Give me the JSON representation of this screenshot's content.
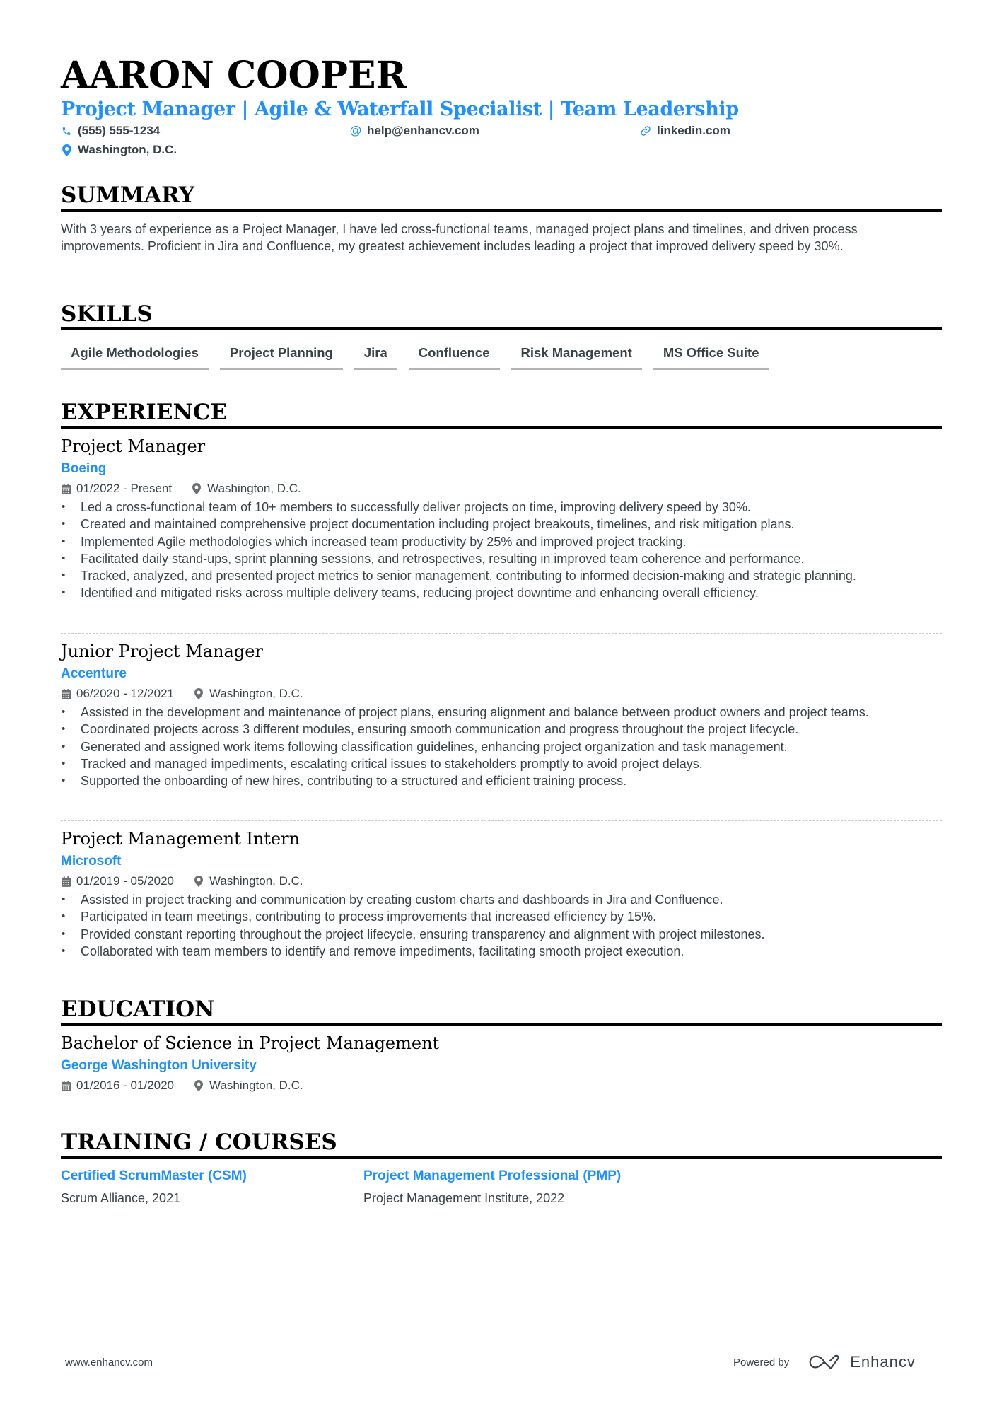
{
  "header": {
    "name": "AARON COOPER",
    "title": "Project Manager | Agile & Waterfall Specialist | Team Leadership",
    "contacts": [
      {
        "icon": "phone-icon",
        "text": "(555) 555-1234"
      },
      {
        "icon": "at-icon",
        "text": "help@enhancv.com"
      },
      {
        "icon": "link-icon",
        "text": "linkedin.com"
      },
      {
        "icon": "location-pin-icon",
        "text": "Washington, D.C."
      }
    ]
  },
  "colors": {
    "accent": "#1e90ff",
    "text": "#384347",
    "heading": "#000000",
    "skill_underline": "#b3b3b3"
  },
  "summary": {
    "title": "SUMMARY",
    "text": "With 3 years of experience as a Project Manager, I have led cross-functional teams, managed project plans and timelines, and driven process improvements. Proficient in Jira and Confluence, my greatest achievement includes leading a project that improved delivery speed by 30%."
  },
  "skills": {
    "title": "SKILLS",
    "items": [
      "Agile Methodologies",
      "Project Planning",
      "Jira",
      "Confluence",
      "Risk Management",
      "MS Office Suite"
    ]
  },
  "experience": {
    "title": "EXPERIENCE",
    "items": [
      {
        "role": "Project Manager",
        "company": "Boeing",
        "dates": "01/2022 - Present",
        "location": "Washington, D.C.",
        "bullets": [
          "Led a cross-functional team of 10+ members to successfully deliver projects on time, improving delivery speed by 30%.",
          "Created and maintained comprehensive project documentation including project breakouts, timelines, and risk mitigation plans.",
          "Implemented Agile methodologies which increased team productivity by 25% and improved project tracking.",
          "Facilitated daily stand-ups, sprint planning sessions, and retrospectives, resulting in improved team coherence and performance.",
          "Tracked, analyzed, and presented project metrics to senior management, contributing to informed decision-making and strategic planning.",
          "Identified and mitigated risks across multiple delivery teams, reducing project downtime and enhancing overall efficiency."
        ]
      },
      {
        "role": "Junior Project Manager",
        "company": "Accenture",
        "dates": "06/2020 - 12/2021",
        "location": "Washington, D.C.",
        "bullets": [
          "Assisted in the development and maintenance of project plans, ensuring alignment and balance between product owners and project teams.",
          "Coordinated projects across 3 different modules, ensuring smooth communication and progress throughout the project lifecycle.",
          "Generated and assigned work items following classification guidelines, enhancing project organization and task management.",
          "Tracked and managed impediments, escalating critical issues to stakeholders promptly to avoid project delays.",
          "Supported the onboarding of new hires, contributing to a structured and efficient training process."
        ]
      },
      {
        "role": "Project Management Intern",
        "company": "Microsoft",
        "dates": "01/2019 - 05/2020",
        "location": "Washington, D.C.",
        "bullets": [
          "Assisted in project tracking and communication by creating custom charts and dashboards in Jira and Confluence.",
          "Participated in team meetings, contributing to process improvements that increased efficiency by 15%.",
          "Provided constant reporting throughout the project lifecycle, ensuring transparency and alignment with project milestones.",
          "Collaborated with team members to identify and remove impediments, facilitating smooth project execution."
        ]
      }
    ]
  },
  "education": {
    "title": "EDUCATION",
    "items": [
      {
        "degree": "Bachelor of Science in Project Management",
        "school": "George Washington University",
        "dates": "01/2016 - 01/2020",
        "location": "Washington, D.C."
      }
    ]
  },
  "training": {
    "title": "TRAINING / COURSES",
    "items": [
      {
        "title": "Certified ScrumMaster (CSM)",
        "detail": "Scrum Alliance, 2021"
      },
      {
        "title": "Project Management Professional (PMP)",
        "detail": "Project Management Institute, 2022"
      }
    ]
  },
  "footer": {
    "url": "www.enhancv.com",
    "powered_by": "Powered by",
    "brand": "Enhancv"
  }
}
